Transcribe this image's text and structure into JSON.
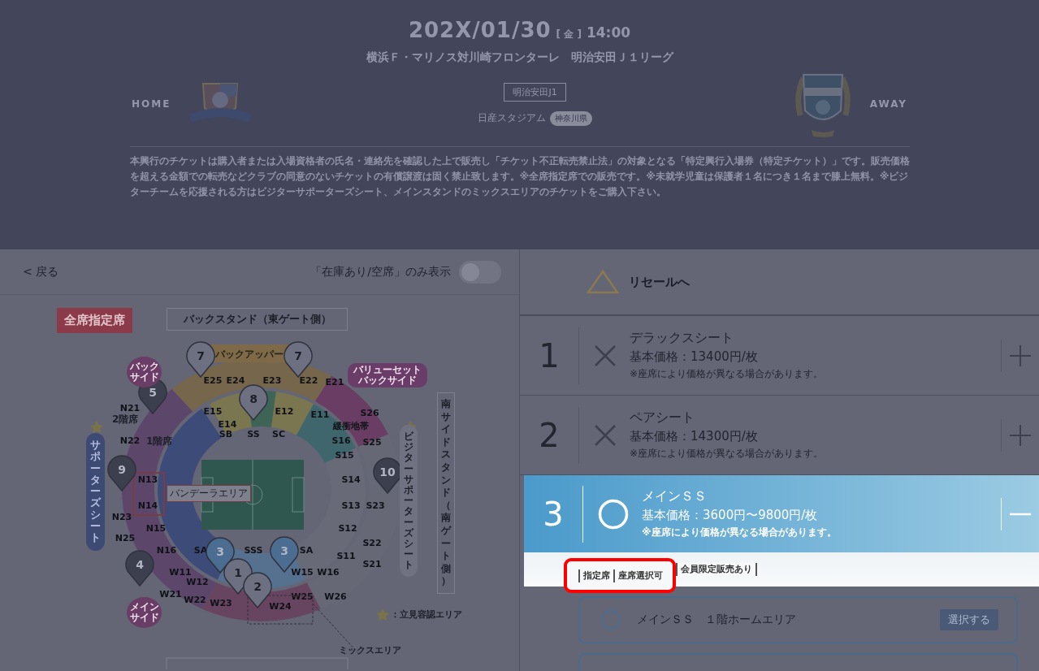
{
  "match": {
    "date": "202X/01/30",
    "weekday": "[ 金 ]",
    "time": "14:00",
    "title": "横浜Ｆ・マリノス対川崎フロンターレ　明治安田Ｊ１リーグ",
    "home_label": "HOME",
    "away_label": "AWAY",
    "league_tag": "明治安田J1",
    "venue": "日産スタジアム",
    "prefecture": "神奈川県",
    "notice": "本興行のチケットは購入者または入場資格者の氏名・連絡先を確認した上で販売し「チケット不正転売禁止法」の対象となる「特定興行入場券（特定チケット）」です。販売価格を超える金額での転売などクラブの同意のないチケットの有償譲渡は固く禁止致します。※全席指定席での販売です。※未就学児童は保護者１名につき１名まで膝上無料。※ビジターチームを応援される方はビジターサポーターズシート、メインスタンドのミックスエリアのチケットをご購入下さい。"
  },
  "left_panel": {
    "back_link": "< 戻る",
    "filter_label": "「在庫あり/空席」のみ表示",
    "filter_on": false
  },
  "seat_map": {
    "badge": "全席指定席",
    "back_stand": "バックスタンド（東ゲート側）",
    "back_upper": "バックアッパー",
    "south_stand": "南サイドスタンド（南ゲート側）",
    "supporters": "サポーターズシート",
    "visitor_supporters": "ビジターサポーターズシート",
    "bandera": "バンデーラエリア",
    "mix_area": "ミックスエリア",
    "standing_legend": "：立見容認エリア",
    "floor_2": "2階席",
    "floor_1": "1階席",
    "back_side": "バックサイド",
    "main_side": "メインサイド",
    "value_set": "バリューセットバックサイド",
    "pins": [
      {
        "label": "7",
        "kind": "light"
      },
      {
        "label": "7",
        "kind": "light"
      },
      {
        "label": "5",
        "kind": "dark"
      },
      {
        "label": "8",
        "kind": "light"
      },
      {
        "label": "9",
        "kind": "dark"
      },
      {
        "label": "10",
        "kind": "dark"
      },
      {
        "label": "4",
        "kind": "dark"
      },
      {
        "label": "3",
        "kind": "blue"
      },
      {
        "label": "3",
        "kind": "blue"
      },
      {
        "label": "1",
        "kind": "light"
      },
      {
        "label": "2",
        "kind": "light"
      }
    ],
    "sections": [
      "E25",
      "E24",
      "E23",
      "E22",
      "E21",
      "N21",
      "E15",
      "E12",
      "E11",
      "S26",
      "E14",
      "緩衝地帯",
      "SB",
      "SS",
      "SC",
      "N22",
      "S16",
      "S25",
      "S15",
      "N13",
      "S14",
      "N14",
      "S13",
      "S23",
      "N23",
      "N15",
      "S12",
      "N25",
      "S22",
      "N16",
      "SA",
      "SSS",
      "SA",
      "S11",
      "S21",
      "W11",
      "W15",
      "W16",
      "W12",
      "W21",
      "W25",
      "W26",
      "W22",
      "W23",
      "W24"
    ]
  },
  "resale": {
    "label": "リセールへ"
  },
  "seat_types": [
    {
      "number": "1",
      "name": "デラックスシート",
      "price": "基本価格：13400円/枚",
      "note": "※座席により価格が異なる場合があります。",
      "kind": "sold_out",
      "expanded": false,
      "selected": false
    },
    {
      "number": "2",
      "name": "ペアシート",
      "price": "基本価格：14300円/枚",
      "note": "※座席により価格が異なる場合があります。",
      "kind": "sold_out",
      "expanded": false,
      "selected": false
    },
    {
      "number": "3",
      "name": "メインＳＳ",
      "price": "基本価格：3600円〜9800円/枚",
      "note": "※座席により価格が異なる場合があります。",
      "kind": "available",
      "expanded": true,
      "selected": true
    }
  ],
  "seat_tags": [
    "指定席",
    "座席選択可",
    "会員限定販売あり"
  ],
  "options": [
    {
      "name": "メインＳＳ　１階ホームエリア",
      "button": "選択する",
      "selected": false
    }
  ]
}
